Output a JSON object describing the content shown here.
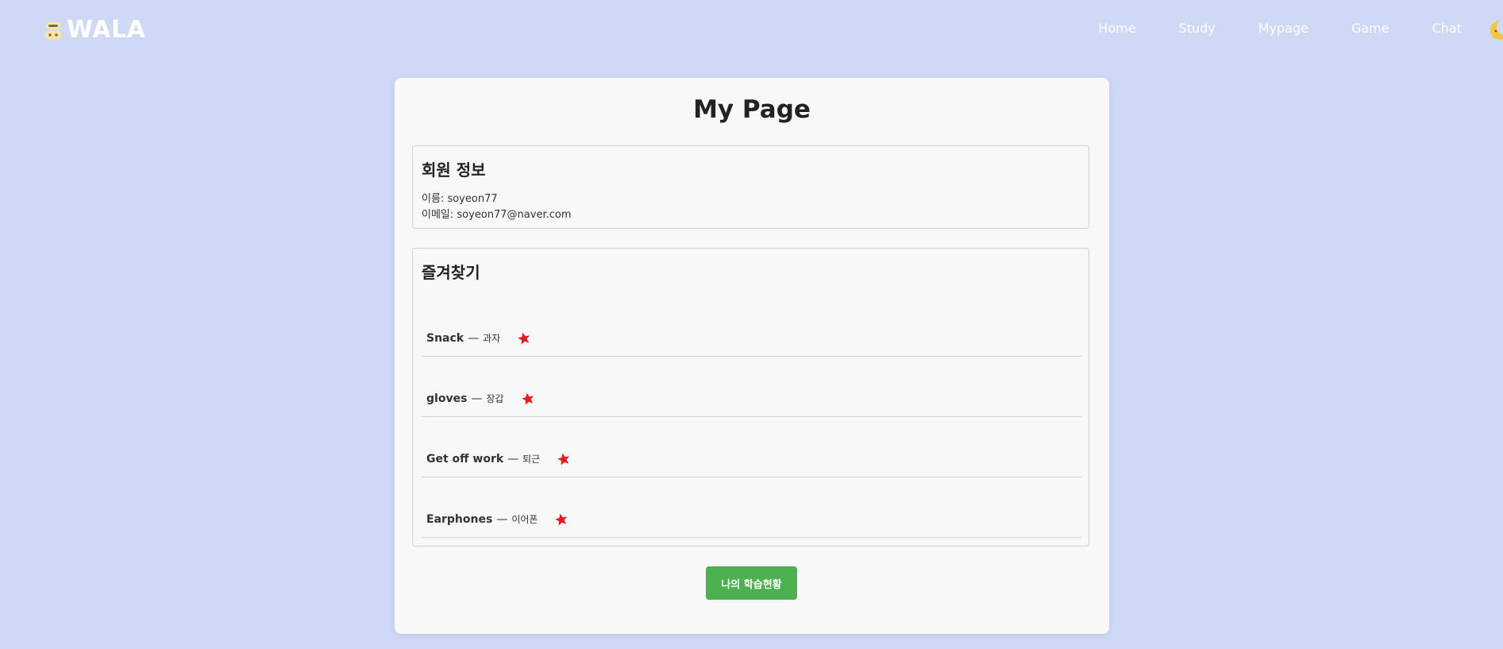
{
  "header": {
    "logo_text": "WALA",
    "nav": [
      "Home",
      "Study",
      "Mypage",
      "Game",
      "Chat"
    ]
  },
  "main": {
    "title": "My Page",
    "member_info": {
      "title": "회원 정보",
      "name_label": "이름:",
      "name_value": "soyeon77",
      "email_label": "이메일:",
      "email_value": "soyeon77@naver.com"
    },
    "favorites": {
      "title": "즐겨찾기",
      "separator": "—",
      "items": [
        {
          "word": "Snack",
          "meaning": "과자"
        },
        {
          "word": "gloves",
          "meaning": "장갑"
        },
        {
          "word": "Get off work",
          "meaning": "퇴근"
        },
        {
          "word": "Earphones",
          "meaning": "이어폰"
        }
      ]
    },
    "progress_button": "나의 학습현황"
  },
  "colors": {
    "background": "#cfd8f5",
    "card": "#f8f8f8",
    "accent_button": "#4caf50",
    "star": "#e31b1b"
  },
  "icons": {
    "logo": "robot-icon",
    "favorite": "star-icon",
    "theme_toggle": "moon-icon"
  }
}
